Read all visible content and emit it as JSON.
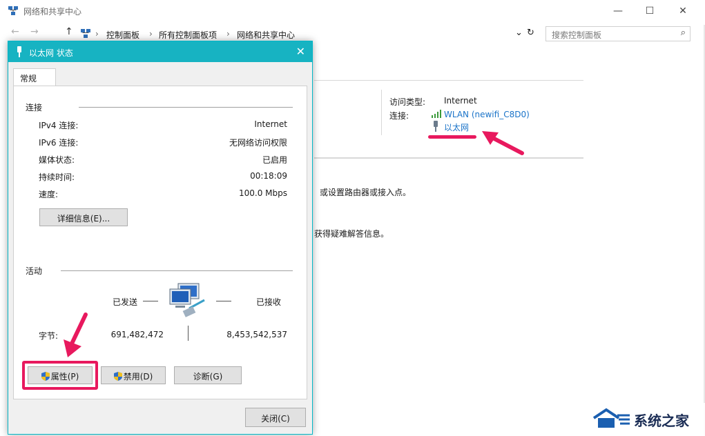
{
  "colors": {
    "accent": "#17b3c2",
    "link": "#1a73c8",
    "highlight": "#e8195e"
  },
  "window": {
    "title": "网络和共享中心",
    "controls": {
      "minimize": "—",
      "maximize": "☐",
      "close": "✕"
    }
  },
  "address_bar": {
    "back": "←",
    "forward": "→",
    "up": "↑",
    "crumbs": [
      "控制面板",
      "所有控制面板项",
      "网络和共享中心"
    ],
    "sep": "›",
    "dropdown": "⌄",
    "refresh": "↻",
    "search_placeholder": "搜索控制面板",
    "search_icon": "⌕"
  },
  "network_info": {
    "access_type_label": "访问类型:",
    "access_type_value": "Internet",
    "connection_label": "连接:",
    "connections": [
      "WLAN (newifi_C8D0)",
      "以太网"
    ]
  },
  "background_text": {
    "line1": "或设置路由器或接入点。",
    "line2": "获得疑难解答信息。"
  },
  "dialog": {
    "title": "以太网 状态",
    "close": "✕",
    "tab": "常规",
    "connection_section": "连接",
    "rows": [
      {
        "label": "IPv4 连接:",
        "value": "Internet"
      },
      {
        "label": "IPv6 连接:",
        "value": "无网络访问权限"
      },
      {
        "label": "媒体状态:",
        "value": "已启用"
      },
      {
        "label": "持续时间:",
        "value": "00:18:09"
      },
      {
        "label": "速度:",
        "value": "100.0 Mbps"
      }
    ],
    "details_button": "详细信息(E)...",
    "activity_section": "活动",
    "sent_label": "已发送",
    "received_label": "已接收",
    "bytes_label": "字节:",
    "bytes_sent": "691,482,472",
    "bytes_received": "8,453,542,537",
    "properties_button": "属性(P)",
    "disable_button": "禁用(D)",
    "diagnose_button": "诊断(G)",
    "close_button": "关闭(C)"
  },
  "watermark": {
    "text": "系统之家"
  }
}
